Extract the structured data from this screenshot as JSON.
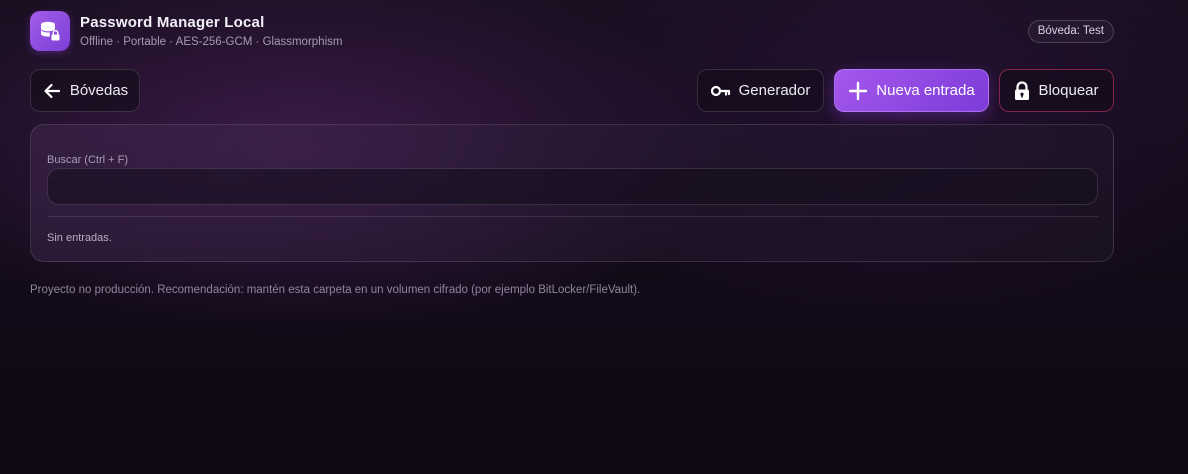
{
  "app": {
    "title": "Password Manager Local",
    "subtitle": "Offline · Portable · AES-256-GCM · Glassmorphism",
    "logo_icon": "database-lock-icon"
  },
  "vault_badge": "Bóveda: Test",
  "toolbar": {
    "back_label": "Bóvedas",
    "back_icon": "arrow-left-icon",
    "generator_label": "Generador",
    "generator_icon": "key-icon",
    "new_entry_label": "Nueva entrada",
    "new_entry_icon": "plus-icon",
    "lock_label": "Bloquear",
    "lock_icon": "lock-icon"
  },
  "search": {
    "label": "Buscar (Ctrl + F)",
    "value": "",
    "placeholder": ""
  },
  "entries": {
    "empty_text": "Sin entradas."
  },
  "footer": {
    "note": "Proyecto no producción. Recomendación: mantén esta carpeta en un volumen cifrado (por ejemplo BitLocker/FileVault)."
  },
  "colors": {
    "accent": "#9b4fe6",
    "lock_border": "#d63c6e",
    "background": "#140b1a"
  }
}
